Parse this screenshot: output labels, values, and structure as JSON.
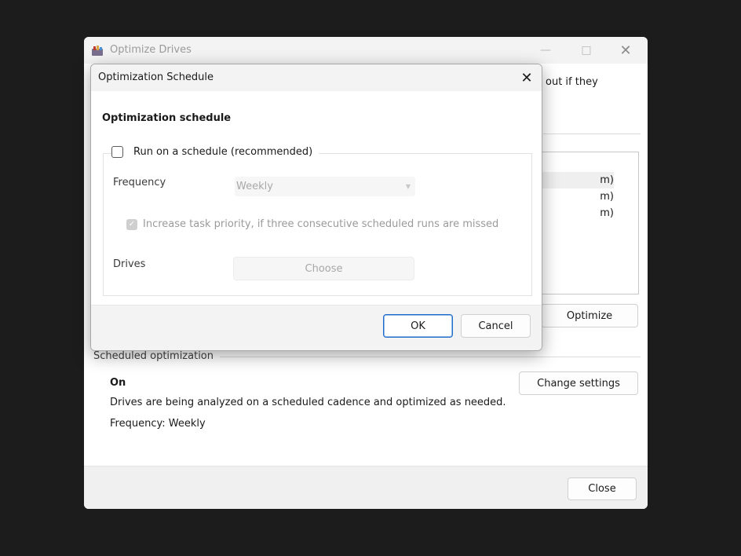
{
  "main_window": {
    "title": "Optimize Drives",
    "description_fragment": "out if they",
    "drive_list_fragments": [
      "m)",
      "m)",
      "m)"
    ],
    "optimize_label": "Optimize",
    "scheduled_group_label": "Scheduled optimization",
    "scheduled_status": "On",
    "scheduled_description": "Drives are being analyzed on a scheduled cadence and optimized as needed.",
    "scheduled_frequency": "Frequency: Weekly",
    "change_settings_label": "Change settings",
    "close_label": "Close"
  },
  "dialog": {
    "title": "Optimization Schedule",
    "heading": "Optimization schedule",
    "run_on_schedule": {
      "label": "Run on a schedule (recommended)",
      "checked": false
    },
    "frequency_label": "Frequency",
    "frequency_value": "Weekly",
    "priority": {
      "label": "Increase task priority, if three consecutive scheduled runs are missed",
      "checked": true,
      "disabled": true
    },
    "drives_label": "Drives",
    "choose_label": "Choose",
    "ok_label": "OK",
    "cancel_label": "Cancel"
  },
  "icons": {
    "app": "defrag-app-icon",
    "close": "close-icon",
    "chevron": "chevron-down-icon",
    "check": "checkmark-icon"
  },
  "colors": {
    "accent": "#1e6cc8",
    "backdrop": "#1c1c1c"
  }
}
